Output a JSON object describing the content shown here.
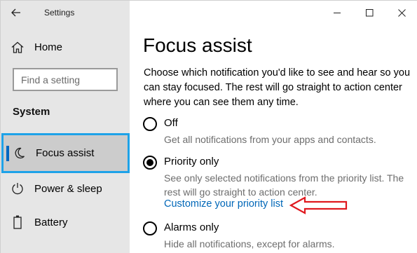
{
  "app": {
    "title": "Settings"
  },
  "sidebar": {
    "home_label": "Home",
    "search_placeholder": "Find a setting",
    "section_title": "System",
    "items": [
      {
        "label": "Focus assist",
        "selected": true,
        "icon": "moon-icon"
      },
      {
        "label": "Power & sleep",
        "icon": "power-icon"
      },
      {
        "label": "Battery",
        "icon": "battery-icon"
      }
    ]
  },
  "main": {
    "title": "Focus assist",
    "description": "Choose which notification you'd like to see and hear so you can stay focused. The rest will go straight to action center where you can see them any time.",
    "options": [
      {
        "label": "Off",
        "description": "Get all notifications from your apps and contacts.",
        "checked": false
      },
      {
        "label": "Priority only",
        "description": "See only selected notifications from the priority list. The rest will go straight to action center.",
        "checked": true,
        "link": "Customize your priority list"
      },
      {
        "label": "Alarms only",
        "description": "Hide all notifications, except for alarms.",
        "checked": false
      }
    ]
  },
  "colors": {
    "accent": "#0067c0",
    "highlight_border": "#1ea2e8",
    "annotation_arrow": "#e0191f"
  }
}
